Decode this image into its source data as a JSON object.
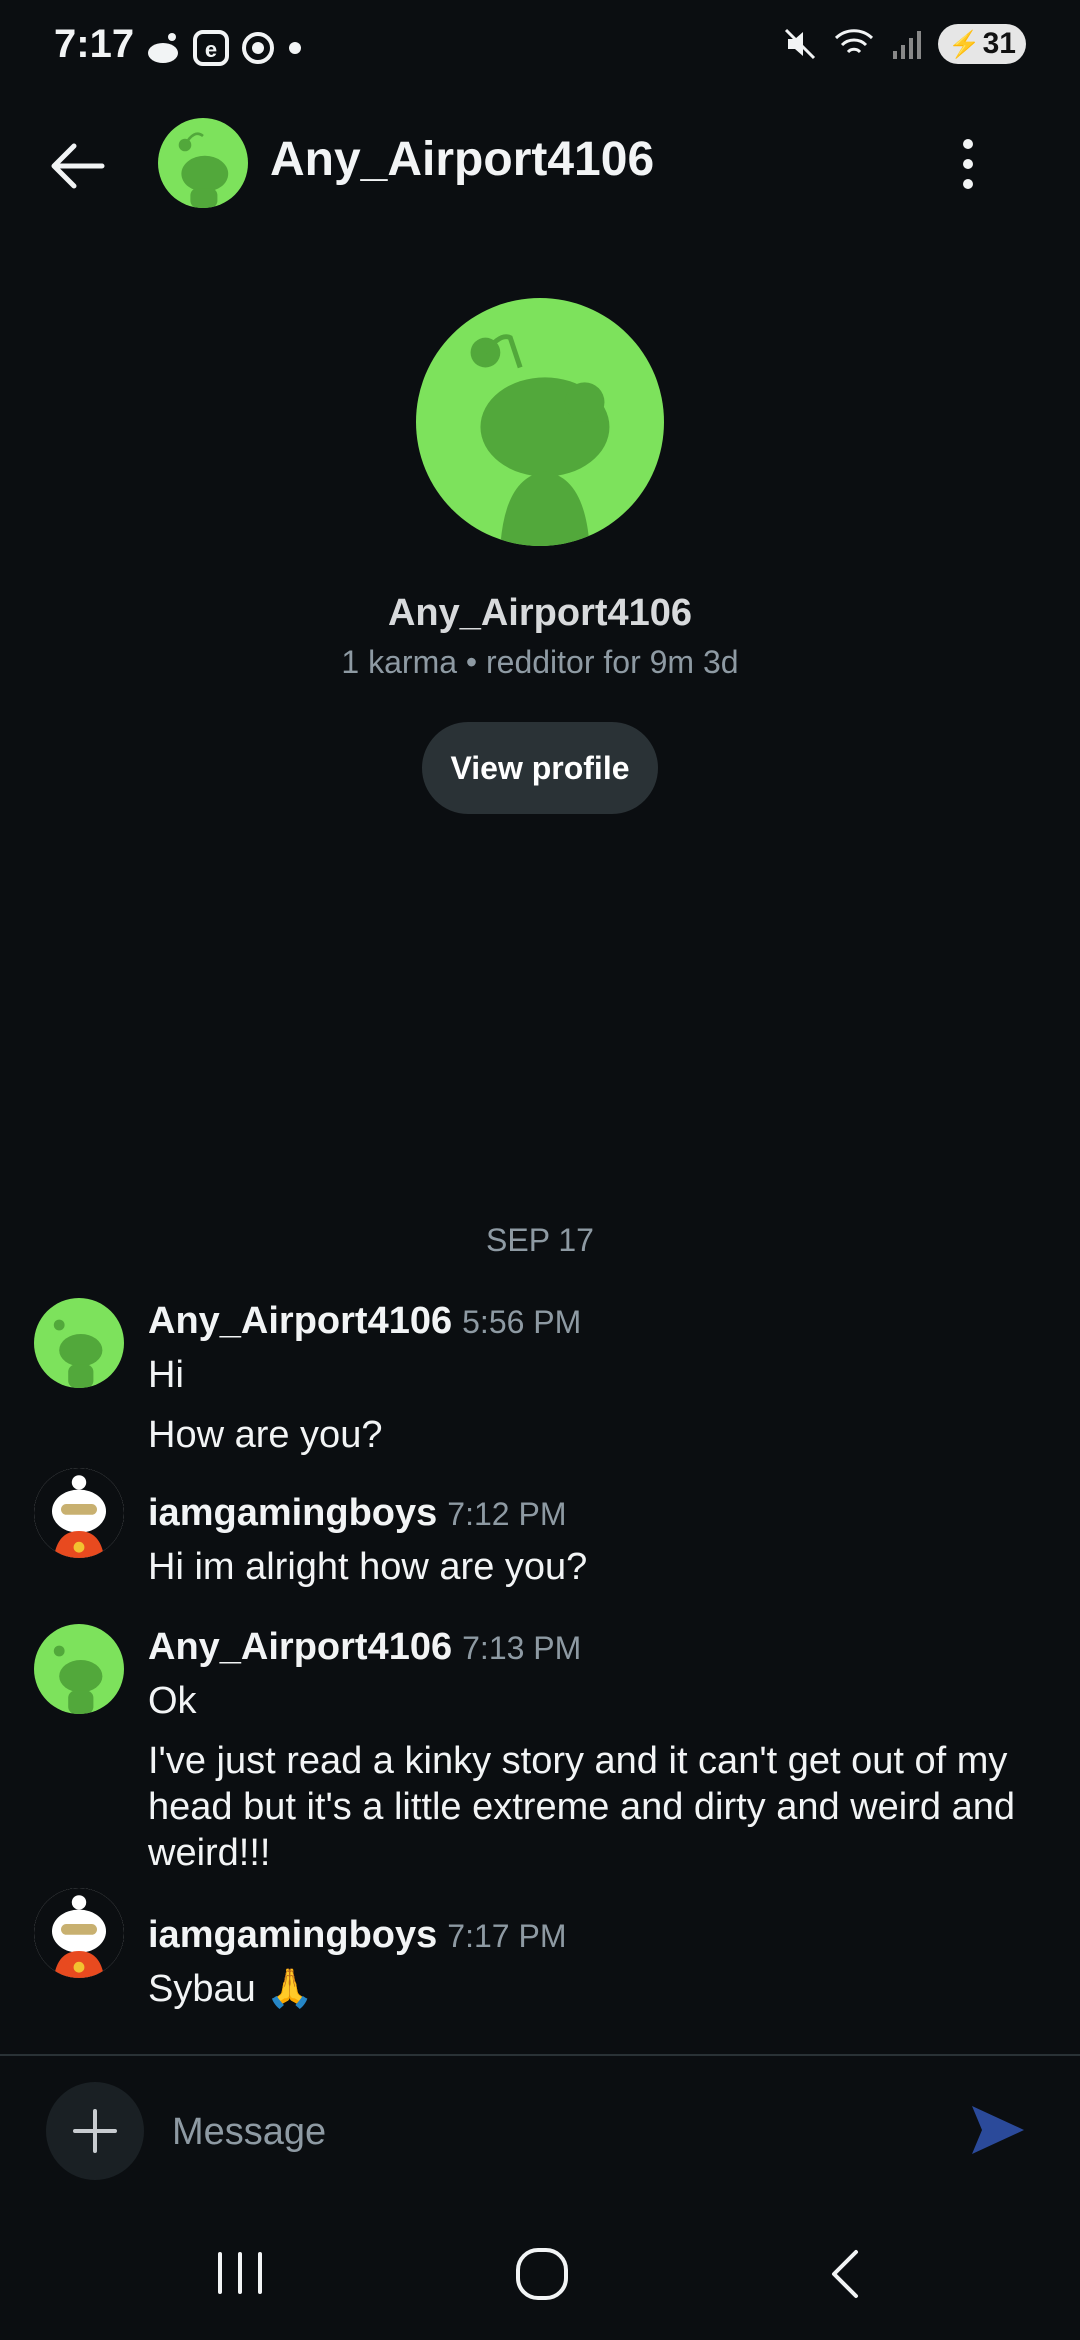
{
  "status_bar": {
    "time": "7:17",
    "battery": "31",
    "icons": [
      "reddit-icon",
      "e-icon",
      "chrome-icon",
      "dot-icon",
      "mute-icon",
      "wifi-icon",
      "signal-icon",
      "battery-icon"
    ]
  },
  "header": {
    "title": "Any_Airport4106"
  },
  "profile": {
    "name": "Any_Airport4106",
    "meta": "1 karma • redditor for 9m 3d",
    "view_profile_label": "View profile"
  },
  "chat": {
    "date_separator": "SEP 17",
    "messages": [
      {
        "author": "Any_Airport4106",
        "time": "5:56 PM",
        "lines": [
          "Hi",
          "How are you?"
        ]
      },
      {
        "author": "iamgamingboys",
        "time": "7:12 PM",
        "lines": [
          "Hi im alright how are you?"
        ]
      },
      {
        "author": "Any_Airport4106",
        "time": "7:13 PM",
        "lines": [
          "Ok",
          "I've just read a kinky story and it can't get out of my head but it's a little extreme and dirty and weird and weird!!!"
        ]
      },
      {
        "author": "iamgamingboys",
        "time": "7:17 PM",
        "lines": [
          "Sybau 🙏"
        ]
      }
    ]
  },
  "composer": {
    "placeholder": "Message"
  },
  "colors": {
    "background": "#0b0e11",
    "avatar_green": "#7de25c",
    "muted_text": "#8e9aa3",
    "button_bg": "#2a3236",
    "send_blue": "#2b4a9a"
  }
}
